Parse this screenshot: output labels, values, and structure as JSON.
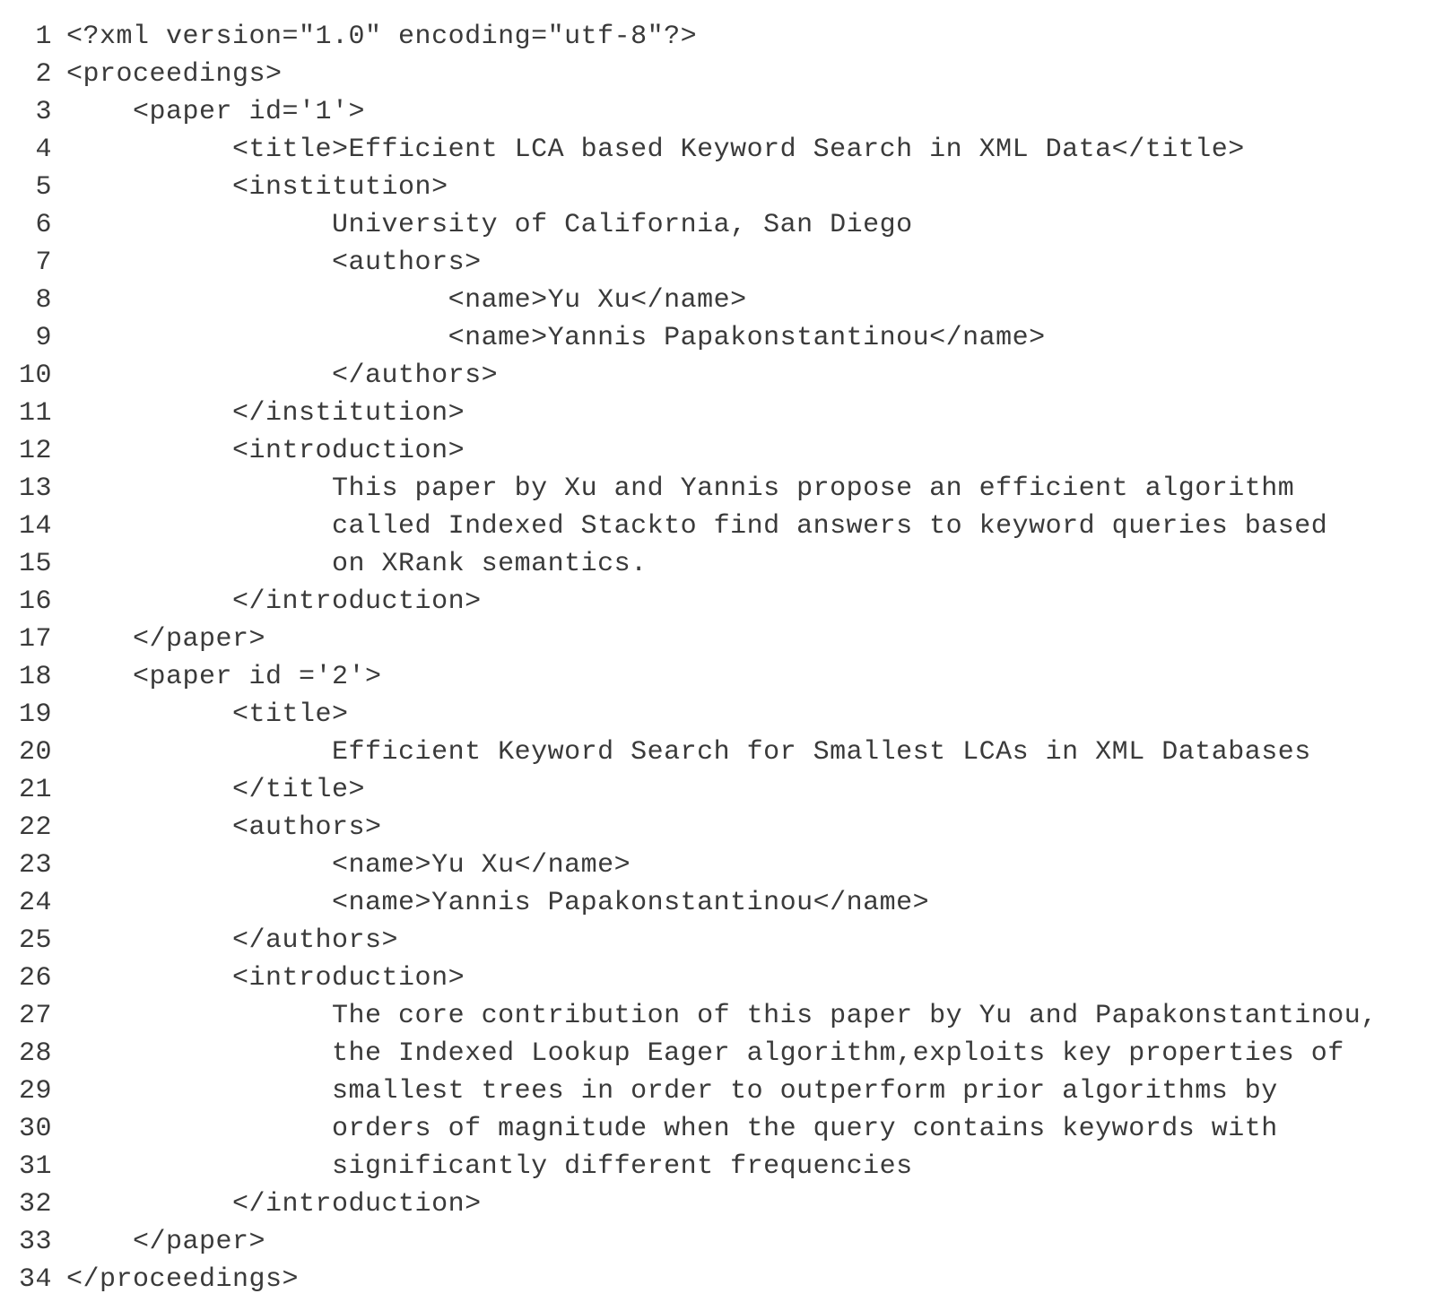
{
  "lines": [
    {
      "n": "1",
      "t": "<?xml version=\"1.0\" encoding=\"utf-8\"?>"
    },
    {
      "n": "2",
      "t": "<proceedings>"
    },
    {
      "n": "3",
      "t": "    <paper id='1'>"
    },
    {
      "n": "4",
      "t": "          <title>Efficient LCA based Keyword Search in XML Data</title>"
    },
    {
      "n": "5",
      "t": "          <institution>"
    },
    {
      "n": "6",
      "t": "                University of California, San Diego"
    },
    {
      "n": "7",
      "t": "                <authors>"
    },
    {
      "n": "8",
      "t": "                       <name>Yu Xu</name>"
    },
    {
      "n": "9",
      "t": "                       <name>Yannis Papakonstantinou</name>"
    },
    {
      "n": "10",
      "t": "                </authors>"
    },
    {
      "n": "11",
      "t": "          </institution>"
    },
    {
      "n": "12",
      "t": "          <introduction>"
    },
    {
      "n": "13",
      "t": "                This paper by Xu and Yannis propose an efficient algorithm"
    },
    {
      "n": "14",
      "t": "                called Indexed Stackto find answers to keyword queries based"
    },
    {
      "n": "15",
      "t": "                on XRank semantics."
    },
    {
      "n": "16",
      "t": "          </introduction>"
    },
    {
      "n": "17",
      "t": "    </paper>"
    },
    {
      "n": "18",
      "t": "    <paper id ='2'>"
    },
    {
      "n": "19",
      "t": "          <title>"
    },
    {
      "n": "20",
      "t": "                Efficient Keyword Search for Smallest LCAs in XML Databases"
    },
    {
      "n": "21",
      "t": "          </title>"
    },
    {
      "n": "22",
      "t": "          <authors>"
    },
    {
      "n": "23",
      "t": "                <name>Yu Xu</name>"
    },
    {
      "n": "24",
      "t": "                <name>Yannis Papakonstantinou</name>"
    },
    {
      "n": "25",
      "t": "          </authors>"
    },
    {
      "n": "26",
      "t": "          <introduction>"
    },
    {
      "n": "27",
      "t": "                The core contribution of this paper by Yu and Papakonstantinou,"
    },
    {
      "n": "28",
      "t": "                the Indexed Lookup Eager algorithm,exploits key properties of"
    },
    {
      "n": "29",
      "t": "                smallest trees in order to outperform prior algorithms by"
    },
    {
      "n": "30",
      "t": "                orders of magnitude when the query contains keywords with"
    },
    {
      "n": "31",
      "t": "                significantly different frequencies"
    },
    {
      "n": "32",
      "t": "          </introduction>"
    },
    {
      "n": "33",
      "t": "    </paper>"
    },
    {
      "n": "34",
      "t": "</proceedings>"
    }
  ]
}
